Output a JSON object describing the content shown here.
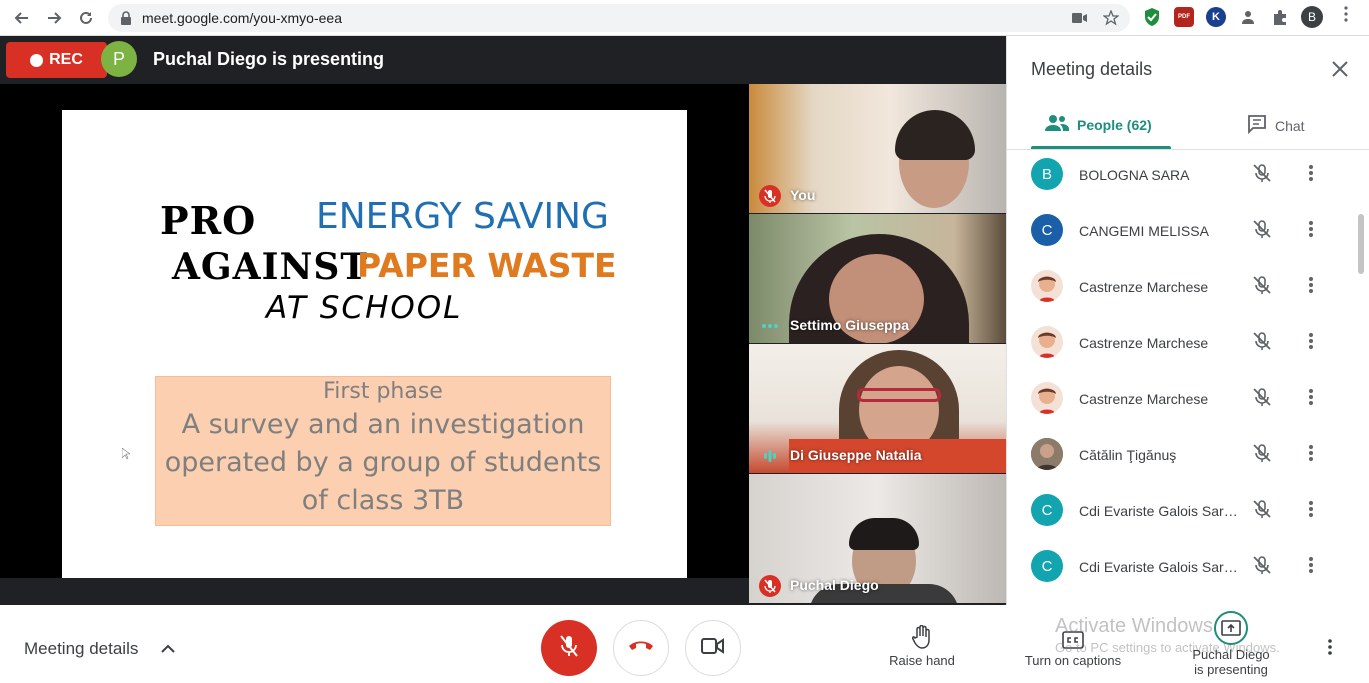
{
  "browser": {
    "url": "meet.google.com/you-xmyo-eea",
    "profile_initial": "B",
    "ext_k": "K",
    "ext_pdf": "PDF"
  },
  "meeting": {
    "rec_label": "REC",
    "presenter_initial": "P",
    "presenting_text": "Puchal Diego is presenting"
  },
  "slide": {
    "line1_left": "PRO",
    "line1_right": "ENERGY SAVING",
    "line2_left": "AGAINST",
    "line2_right": "PAPER WASTE",
    "line3": "AT SCHOOL",
    "box_title": "First phase",
    "box_text": "A survey and an investigation operated by a group of students of class 3TB"
  },
  "tiles": [
    {
      "name": "You",
      "status": "muted"
    },
    {
      "name": "Settimo Giuseppa",
      "status": "idle"
    },
    {
      "name": "Di Giuseppe Natalia",
      "status": "speaking"
    },
    {
      "name": "Puchal Diego",
      "status": "muted"
    }
  ],
  "panel": {
    "title": "Meeting details",
    "people_tab": "People (62)",
    "chat_tab": "Chat",
    "people": [
      {
        "initial": "B",
        "name": "BOLOGNA SARA",
        "color": "#12a4af"
      },
      {
        "initial": "C",
        "name": "CANGEMI MELISSA",
        "color": "#1a5fa8"
      },
      {
        "initial": "",
        "name": "Castrenze Marchese",
        "color": "#f4e1d6"
      },
      {
        "initial": "",
        "name": "Castrenze Marchese",
        "color": "#f4e1d6"
      },
      {
        "initial": "",
        "name": "Castrenze Marchese",
        "color": "#f4e1d6"
      },
      {
        "initial": "",
        "name": "Cătălin Ţigănuş",
        "color": "#6b5a4a"
      },
      {
        "initial": "C",
        "name": "Cdi Evariste Galois Sart...",
        "color": "#12a4af"
      },
      {
        "initial": "C",
        "name": "Cdi Evariste Galois Sart...",
        "color": "#12a4af"
      }
    ]
  },
  "bottom": {
    "meeting_details": "Meeting details",
    "raise_hand": "Raise hand",
    "captions": "Turn on captions",
    "presenting_line1": "Puchal Diego",
    "presenting_line2": "is presenting",
    "watermark_line1": "Activate Windows",
    "watermark_line2": "Go to PC settings to activate Windows."
  },
  "colors": {
    "accent": "#1e8e7e",
    "danger": "#d93025",
    "stage_bg": "#202124"
  }
}
